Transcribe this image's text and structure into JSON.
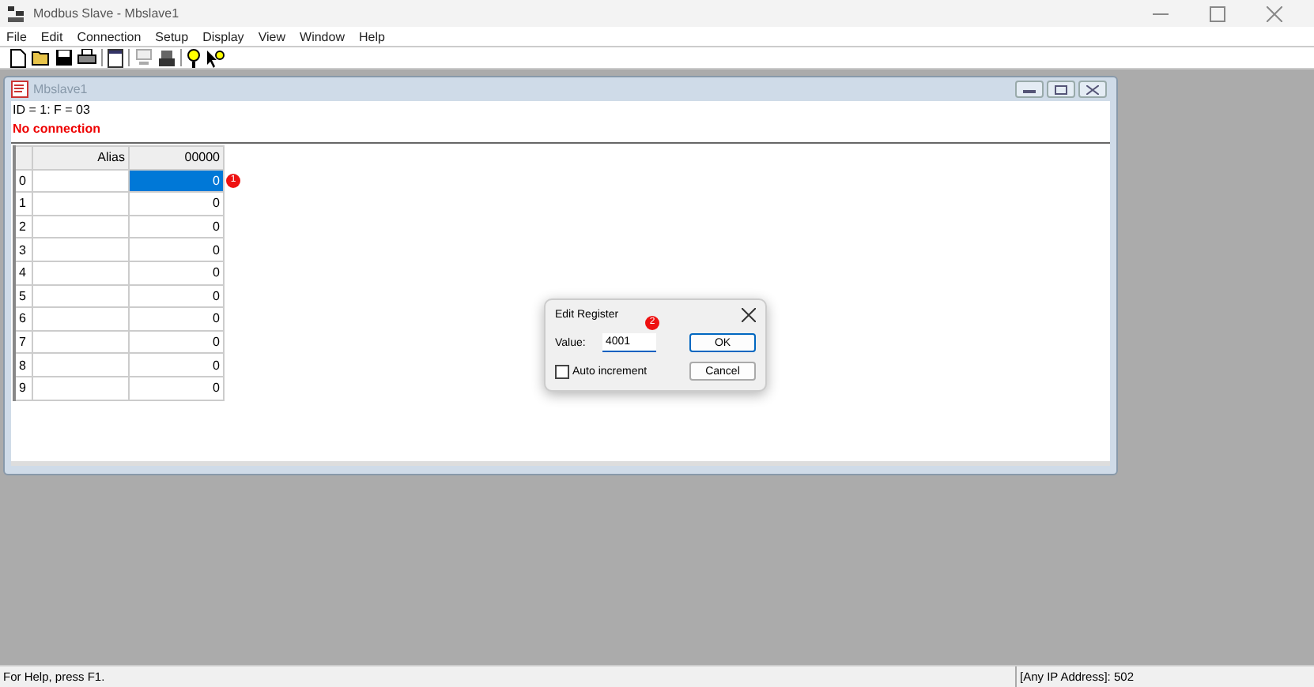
{
  "window": {
    "title": "Modbus Slave - Mbslave1"
  },
  "menu": [
    "File",
    "Edit",
    "Connection",
    "Setup",
    "Display",
    "View",
    "Window",
    "Help"
  ],
  "child": {
    "title": "Mbslave1",
    "info": "ID = 1: F = 03",
    "status": "No connection",
    "columns": [
      "Alias",
      "00000"
    ],
    "rows": [
      {
        "index": "0",
        "alias": "",
        "value": "0",
        "selected": true,
        "badge": "1"
      },
      {
        "index": "1",
        "alias": "",
        "value": "0",
        "selected": false
      },
      {
        "index": "2",
        "alias": "",
        "value": "0",
        "selected": false
      },
      {
        "index": "3",
        "alias": "",
        "value": "0",
        "selected": false
      },
      {
        "index": "4",
        "alias": "",
        "value": "0",
        "selected": false
      },
      {
        "index": "5",
        "alias": "",
        "value": "0",
        "selected": false
      },
      {
        "index": "6",
        "alias": "",
        "value": "0",
        "selected": false
      },
      {
        "index": "7",
        "alias": "",
        "value": "0",
        "selected": false
      },
      {
        "index": "8",
        "alias": "",
        "value": "0",
        "selected": false
      },
      {
        "index": "9",
        "alias": "",
        "value": "0",
        "selected": false
      }
    ]
  },
  "dialog": {
    "title": "Edit Register",
    "value_label": "Value:",
    "value": "4001",
    "badge": "2",
    "ok": "OK",
    "cancel": "Cancel",
    "auto_increment": {
      "label": "Auto increment",
      "checked": false
    }
  },
  "status_bar": {
    "help": "For Help, press F1.",
    "address": "[Any IP Address]: 502"
  }
}
